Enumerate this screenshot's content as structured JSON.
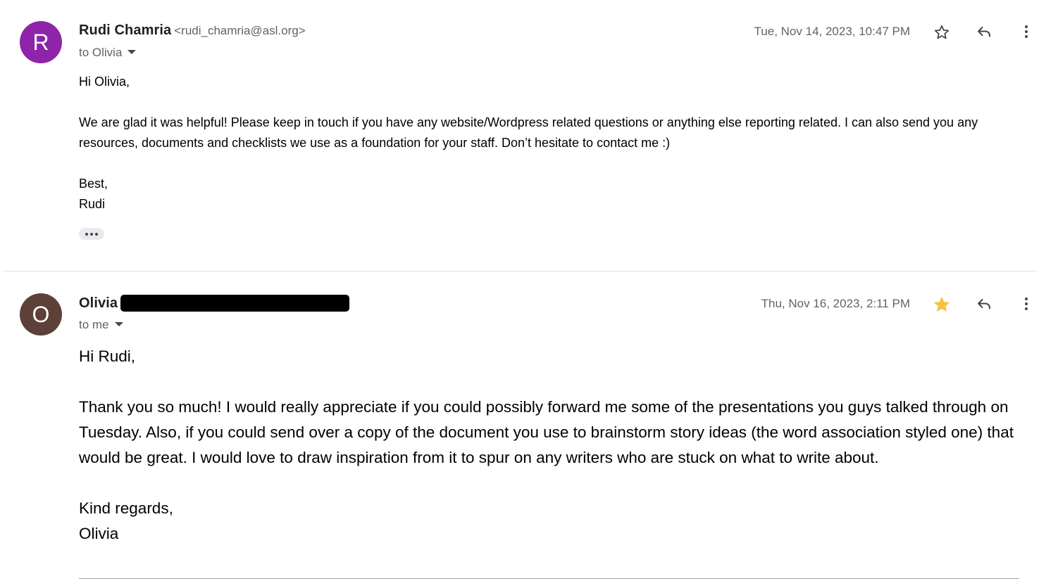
{
  "messages": [
    {
      "avatar_letter": "R",
      "avatar_color": "#8e24aa",
      "sender_name": "Rudi Chamria",
      "sender_email": "<rudi_chamria@asl.org>",
      "recipient": "to Olivia",
      "date": "Tue, Nov 14, 2023, 10:47 PM",
      "starred": false,
      "body": {
        "greeting": "Hi Olivia,",
        "paragraph": "We are glad it was helpful! Please keep in touch if you have any website/Wordpress related questions or anything else reporting related. I can also send you any resources, documents and checklists we use as a foundation for your staff. Don’t hesitate to contact me :)",
        "closing": "Best,",
        "signature": "Rudi"
      }
    },
    {
      "avatar_letter": "O",
      "avatar_color": "#5d4037",
      "sender_name": "Olivia",
      "sender_email_redacted": true,
      "recipient": "to me",
      "date": "Thu, Nov 16, 2023, 2:11 PM",
      "starred": true,
      "body": {
        "greeting": "Hi Rudi,",
        "paragraph": "Thank you so much! I would really appreciate if you could possibly forward me some of the presentations you guys talked through on Tuesday. Also, if you could send over a copy of the document you use to brainstorm story ideas (the word association styled one) that would be great. I would love to draw inspiration from it to spur on any writers who are stuck on what to write about.",
        "closing": "Kind regards,",
        "signature": "Olivia"
      }
    }
  ],
  "icons": {
    "star": "star-icon",
    "reply": "reply-icon",
    "more": "more-vert-icon",
    "show_trimmed": "show-trimmed-content-icon"
  },
  "colors": {
    "star_filled": "#f6c343",
    "icon_gray": "#444746"
  }
}
